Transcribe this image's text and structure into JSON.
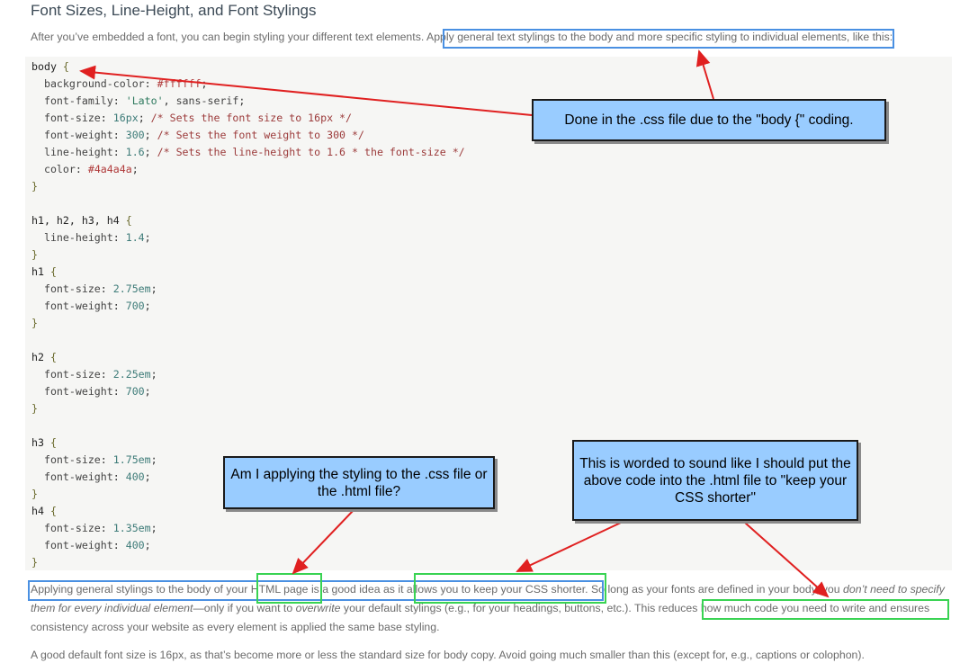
{
  "heading": "Font Sizes, Line-Height, and Font Stylings",
  "intro": {
    "before": "After you’ve embedded a font, you can begin styling your different text elements.",
    "highlight": "Apply general text stylings to the body and more specific styling to individual elements,",
    "after": "like this:"
  },
  "code": {
    "body_sel": "body",
    "body_bg": "#ffffff",
    "body_ff": "'Lato'",
    "body_ff2": "sans-serif",
    "body_fs": "16px",
    "body_fs_c": "/* Sets the font size to 16px */",
    "body_fw": "300",
    "body_fw_c": "/* Sets the font weight to 300 */",
    "body_lh": "1.6",
    "body_lh_c": "/* Sets the line-height to 1.6 * the font-size */",
    "body_color": "#4a4a4a",
    "hsel": "h1, h2, h3, h4",
    "h_lh": "1.4",
    "h1_sel": "h1",
    "h1_fs": "2.75em",
    "h1_fw": "700",
    "h2_sel": "h2",
    "h2_fs": "2.25em",
    "h2_fw": "700",
    "h3_sel": "h3",
    "h3_fs": "1.75em",
    "h3_fw": "400",
    "h4_sel": "h4",
    "h4_fs": "1.35em",
    "h4_fw": "400",
    "p_bg": "background-color",
    "p_ff": "font-family",
    "p_fs": "font-size",
    "p_fw": "font-weight",
    "p_lh": "line-height",
    "p_color": "color"
  },
  "para2": {
    "a": "Applying general stylings to the body of your",
    "b": "HTML page",
    "c": "is a good idea as it",
    "d": "allows you to keep your CSS shorter.",
    "e": "So long as your fonts are defined in your body, you",
    "f": "don’t need to specify them for every individual element",
    "g": "—only if you want to",
    "h": "overwrite",
    "i": "your default stylings (e.g., for your headings, buttons, etc.).",
    "j": "This reduces how much code you need to write",
    "k": "and ensures consistency across your website as every element is applied the same base styling."
  },
  "para3": "A good default font size is 16px, as that’s become more or less the standard size for body copy. Avoid going much smaller than this (except for, e.g., captions or colophon).",
  "callouts": {
    "c1": "Done in the .css file due to the \"body {\" coding.",
    "c2": "Am I applying the styling to the .css file or the .html file?",
    "c3": "This is worded to sound like I should put the above code into the .html file to \"keep your CSS shorter\""
  },
  "colors": {
    "callout_bg": "#99ccff",
    "blue_box": "#4a90e2",
    "green_box": "#39d353",
    "arrow": "#e02020"
  }
}
